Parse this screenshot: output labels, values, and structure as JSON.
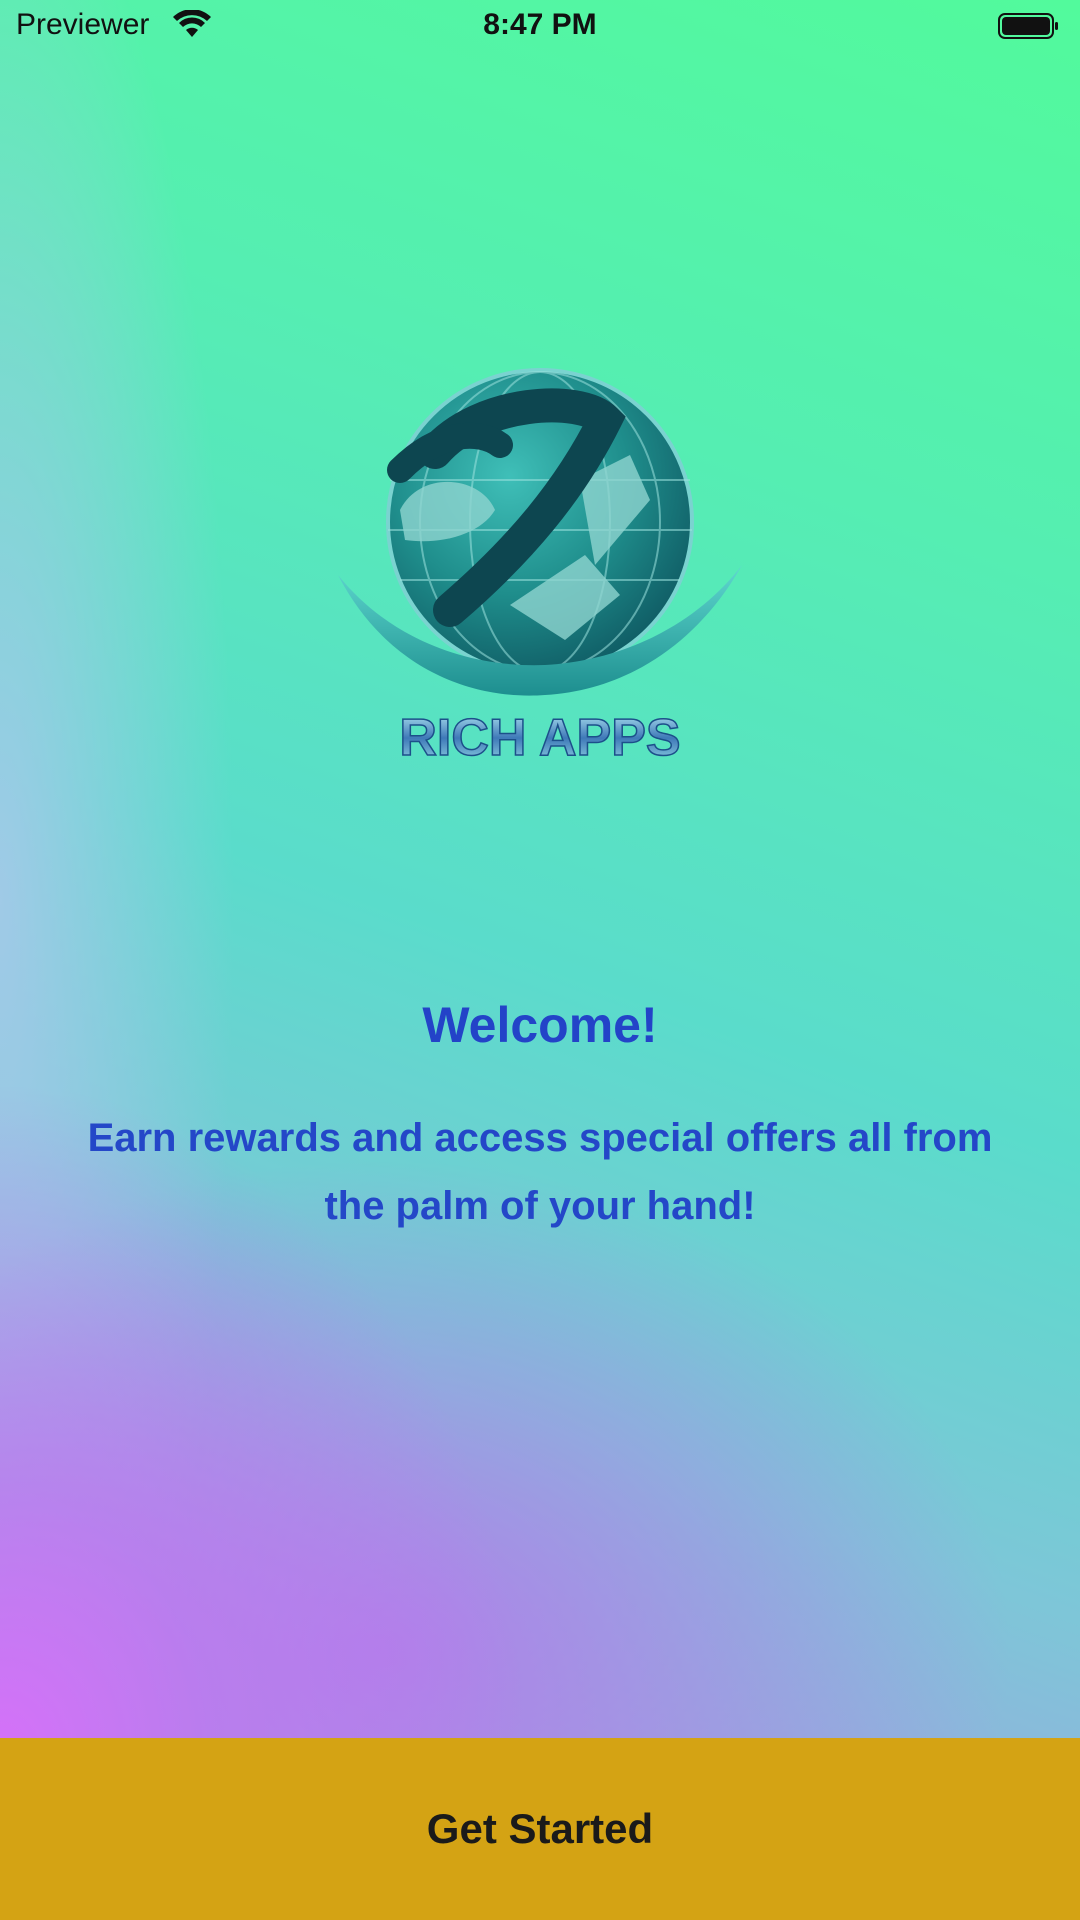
{
  "status_bar": {
    "carrier": "Previewer",
    "time": "8:47 PM",
    "wifi_icon": "wifi-icon",
    "battery_icon": "battery-full-icon"
  },
  "logo": {
    "brand_name": "RICH APPS",
    "icon": "globe-swoosh-logo"
  },
  "welcome": {
    "title": "Welcome!",
    "subtitle": "Earn rewards and access special offers all from the palm of your hand!"
  },
  "cta": {
    "label": "Get Started",
    "color": "#d4a314"
  },
  "colors": {
    "text_accent": "#2343c8",
    "gradient_top": "#52fa9c",
    "gradient_mid": "#5adccb",
    "gradient_bottom_left": "#d86efa"
  }
}
